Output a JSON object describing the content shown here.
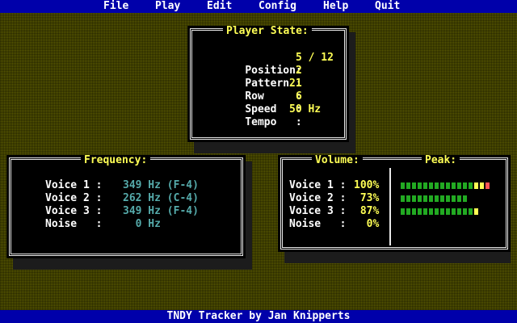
{
  "menu": {
    "items": [
      {
        "label": "File"
      },
      {
        "label": "Play"
      },
      {
        "label": "Edit"
      },
      {
        "label": "Config"
      },
      {
        "label": "Help"
      },
      {
        "label": "Quit"
      }
    ]
  },
  "player_state": {
    "title": "Player State:",
    "position_label": "Position:",
    "position_value": "5 / 12",
    "pattern_label": "Pattern :",
    "pattern_value": "2",
    "row_label": "Row     :",
    "row_value": "21",
    "speed_label": "Speed   :",
    "speed_value": "6",
    "tempo_label": "Tempo   :",
    "tempo_value": "50 Hz"
  },
  "frequency": {
    "title": "Frequency:",
    "rows": [
      {
        "label": "Voice 1 :",
        "value": "349 Hz (F-4)"
      },
      {
        "label": "Voice 2 :",
        "value": "262 Hz (C-4)"
      },
      {
        "label": "Voice 3 :",
        "value": "349 Hz (F-4)"
      },
      {
        "label": "Noise   :",
        "value": "  0 Hz"
      }
    ]
  },
  "volume": {
    "title": "Volume:",
    "rows": [
      {
        "label": "Voice 1 :",
        "value": "100%"
      },
      {
        "label": "Voice 2 :",
        "value": " 73%"
      },
      {
        "label": "Voice 3 :",
        "value": " 87%"
      },
      {
        "label": "Noise   :",
        "value": "  0%"
      }
    ]
  },
  "peak": {
    "title": "Peak:",
    "meters": [
      {
        "name": "Voice 1",
        "level": 1.0
      },
      {
        "name": "Voice 2",
        "level": 0.73
      },
      {
        "name": "Voice 3",
        "level": 0.87
      },
      {
        "name": "Noise",
        "level": 0.0
      }
    ],
    "colors": {
      "low": "#22aa22",
      "mid": "#ffff55",
      "high": "#ff5555",
      "off": "#000000"
    }
  },
  "status": {
    "text": "TNDY Tracker by Jan Knipperts"
  }
}
